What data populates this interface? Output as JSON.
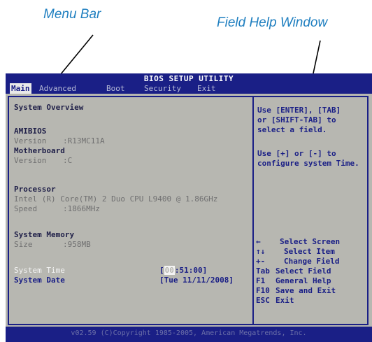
{
  "callouts": {
    "menu_bar": "Menu Bar",
    "field_help": "Field Help Window"
  },
  "bios": {
    "title": "BIOS SETUP UTILITY",
    "menu": [
      {
        "label": "Main",
        "active": true
      },
      {
        "label": "Advanced",
        "active": false
      },
      {
        "label": "Boot",
        "active": false
      },
      {
        "label": "Security",
        "active": false
      },
      {
        "label": "Exit",
        "active": false
      }
    ],
    "overview": {
      "heading": "System Overview",
      "amibios_label": "AMIBIOS",
      "amibios_version_label": "Version",
      "amibios_version": ":R13MC11A",
      "motherboard_label": "Motherboard",
      "mb_version_label": "Version",
      "mb_version": ":C",
      "processor_label": "Processor",
      "processor_name": "Intel (R) Core(TM) 2 Duo CPU  L9400 @ 1.86GHz",
      "speed_label": "Speed",
      "speed": ":1866MHz",
      "memory_label": "System Memory",
      "size_label": "Size",
      "size": ":958MB",
      "time_label": "System Time",
      "time_cursor": "00",
      "time_rest": ":51:00]",
      "time_open": "[",
      "date_label": "System Date",
      "date": "[Tue 11/11/2008]"
    },
    "help": {
      "lines": [
        "Use [ENTER], [TAB]",
        "or [SHIFT-TAB] to",
        "select a field.",
        "",
        "Use [+] or [-] to",
        "configure system Time."
      ],
      "keys": [
        {
          "key": "←",
          "desc": "Select Screen"
        },
        {
          "key": "↑↓",
          "desc": "Select Item"
        },
        {
          "key": "+-",
          "desc": "Change Field"
        },
        {
          "key": "Tab",
          "desc": "Select Field"
        },
        {
          "key": "F1",
          "desc": "General Help"
        },
        {
          "key": "F10",
          "desc": "Save and Exit"
        },
        {
          "key": "ESC",
          "desc": "Exit"
        }
      ]
    },
    "copyright": "v02.59 (C)Copyright 1985-2005, American Megatrends, Inc."
  }
}
